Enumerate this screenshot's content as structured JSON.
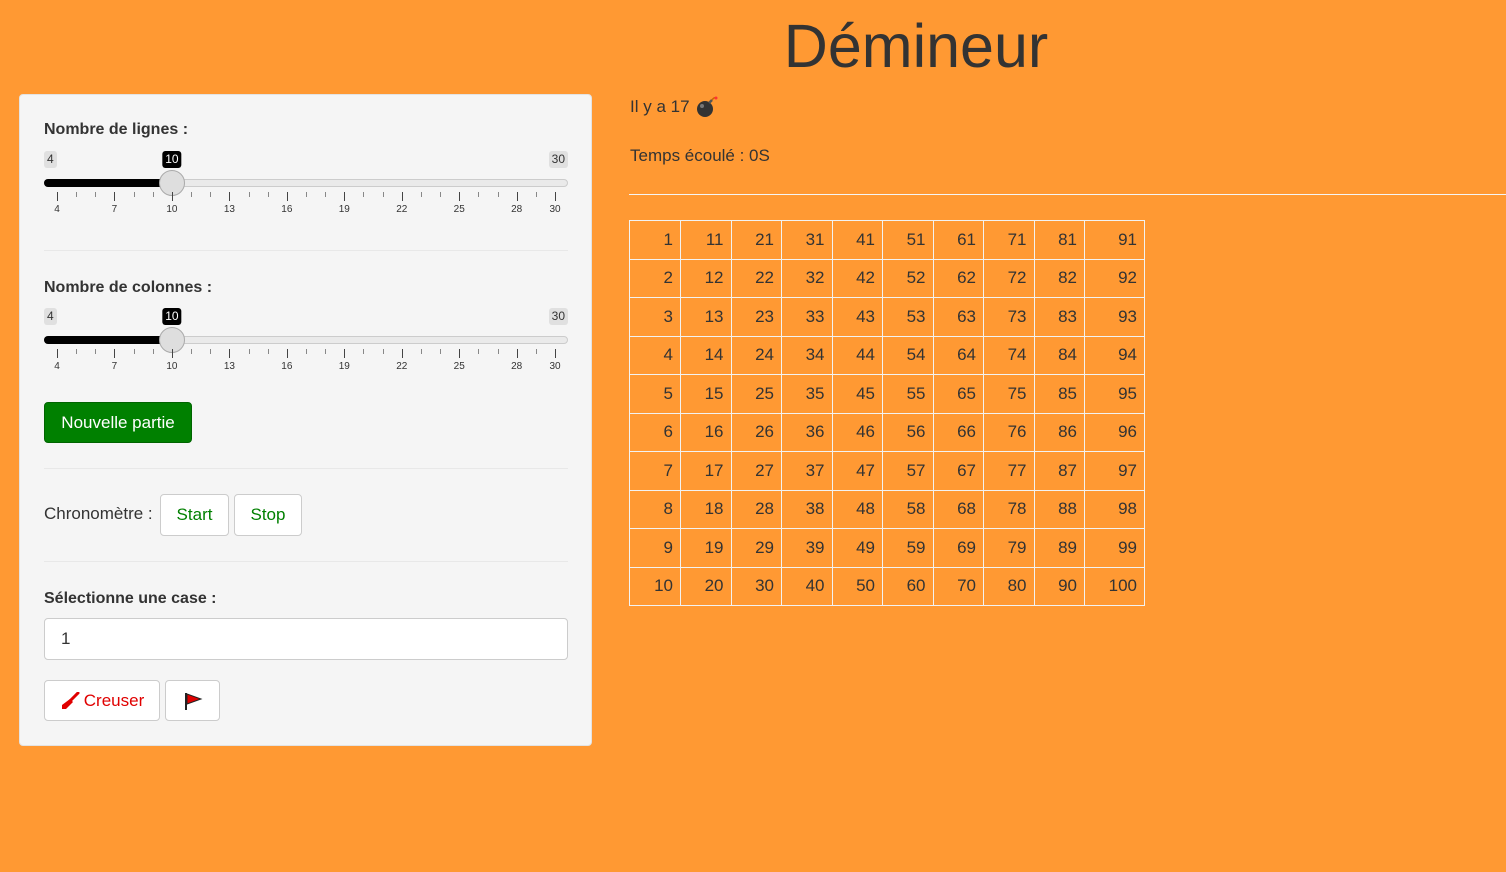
{
  "title": "Démineur",
  "sidebar": {
    "rows_slider": {
      "label": "Nombre de lignes :",
      "min": "4",
      "max": "30",
      "value": "10",
      "min_num": 4,
      "max_num": 30,
      "value_num": 10,
      "tick_labels": [
        "4",
        "7",
        "10",
        "13",
        "16",
        "19",
        "22",
        "25",
        "28",
        "30"
      ]
    },
    "cols_slider": {
      "label": "Nombre de colonnes :",
      "min": "4",
      "max": "30",
      "value": "10",
      "min_num": 4,
      "max_num": 30,
      "value_num": 10,
      "tick_labels": [
        "4",
        "7",
        "10",
        "13",
        "16",
        "19",
        "22",
        "25",
        "28",
        "30"
      ]
    },
    "new_game_label": "Nouvelle partie",
    "chrono": {
      "label": "Chronomètre :",
      "start_label": "Start",
      "stop_label": "Stop"
    },
    "select_cell": {
      "label": "Sélectionne une case :",
      "value": "1"
    },
    "dig_label": "Creuser",
    "dig_icon": "shovel-icon",
    "flag_icon": "flag-icon"
  },
  "main": {
    "bombs_text": "Il y a 17",
    "bomb_icon": "bomb-icon",
    "time_text": "Temps écoulé : 0S"
  },
  "grid": {
    "rows": [
      [
        "1",
        "11",
        "21",
        "31",
        "41",
        "51",
        "61",
        "71",
        "81",
        "91"
      ],
      [
        "2",
        "12",
        "22",
        "32",
        "42",
        "52",
        "62",
        "72",
        "82",
        "92"
      ],
      [
        "3",
        "13",
        "23",
        "33",
        "43",
        "53",
        "63",
        "73",
        "83",
        "93"
      ],
      [
        "4",
        "14",
        "24",
        "34",
        "44",
        "54",
        "64",
        "74",
        "84",
        "94"
      ],
      [
        "5",
        "15",
        "25",
        "35",
        "45",
        "55",
        "65",
        "75",
        "85",
        "95"
      ],
      [
        "6",
        "16",
        "26",
        "36",
        "46",
        "56",
        "66",
        "76",
        "86",
        "96"
      ],
      [
        "7",
        "17",
        "27",
        "37",
        "47",
        "57",
        "67",
        "77",
        "87",
        "97"
      ],
      [
        "8",
        "18",
        "28",
        "38",
        "48",
        "58",
        "68",
        "78",
        "88",
        "98"
      ],
      [
        "9",
        "19",
        "29",
        "39",
        "49",
        "59",
        "69",
        "79",
        "89",
        "99"
      ],
      [
        "10",
        "20",
        "30",
        "40",
        "50",
        "60",
        "70",
        "80",
        "90",
        "100"
      ]
    ]
  },
  "colors": {
    "background": "#ff9933",
    "accent_green": "#008000",
    "dig_red": "#e00000"
  }
}
